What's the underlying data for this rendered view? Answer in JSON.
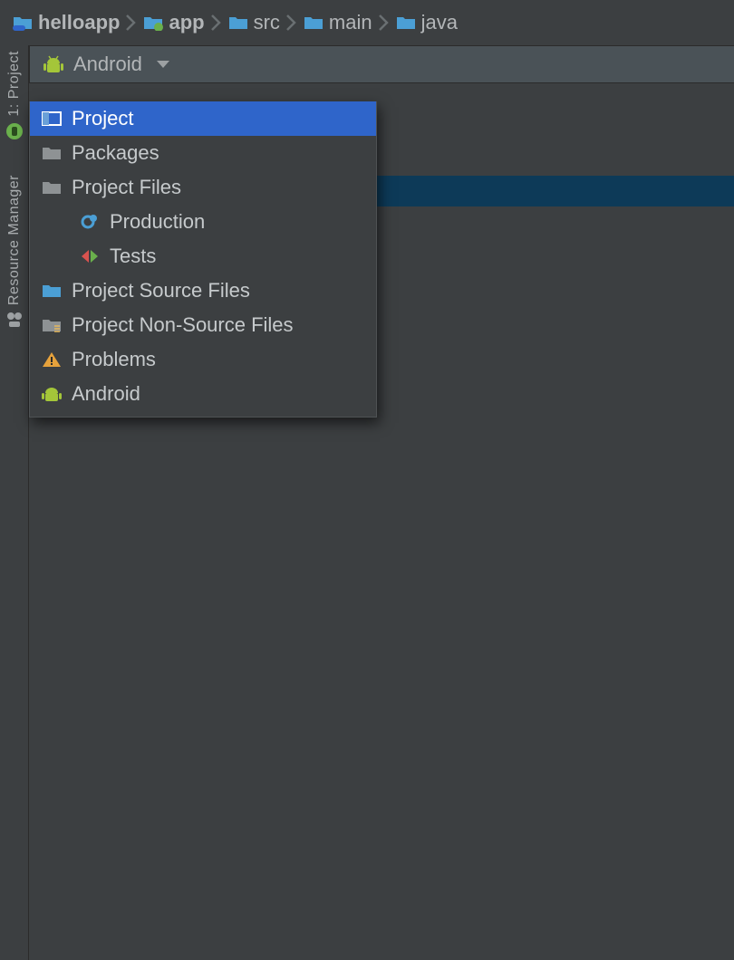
{
  "breadcrumb": {
    "items": [
      {
        "label": "helloapp",
        "bold": true,
        "icon": "project-folder"
      },
      {
        "label": "app",
        "bold": true,
        "icon": "module-folder"
      },
      {
        "label": "src",
        "bold": false,
        "icon": "folder"
      },
      {
        "label": "main",
        "bold": false,
        "icon": "folder"
      },
      {
        "label": "java",
        "bold": false,
        "icon": "folder"
      }
    ]
  },
  "sidebar": {
    "tabs": [
      {
        "label": "1: Project",
        "icon": "android-studio"
      },
      {
        "label": "Resource Manager",
        "icon": "resource-manager"
      }
    ]
  },
  "panel": {
    "current_view": "Android"
  },
  "popup": {
    "items": [
      {
        "label": "Project",
        "icon": "layout",
        "indent": 0,
        "selected": true
      },
      {
        "label": "Packages",
        "icon": "folder-grey",
        "indent": 0
      },
      {
        "label": "Project Files",
        "icon": "folder-grey",
        "indent": 0
      },
      {
        "label": "Production",
        "icon": "gear-blue",
        "indent": 1
      },
      {
        "label": "Tests",
        "icon": "arrows-redgreen",
        "indent": 1
      },
      {
        "label": "Project Source Files",
        "icon": "folder-blue",
        "indent": 0
      },
      {
        "label": "Project Non-Source Files",
        "icon": "folder-yellowlines",
        "indent": 0
      },
      {
        "label": "Problems",
        "icon": "warning",
        "indent": 0
      },
      {
        "label": "Android",
        "icon": "android",
        "indent": 0
      }
    ]
  }
}
